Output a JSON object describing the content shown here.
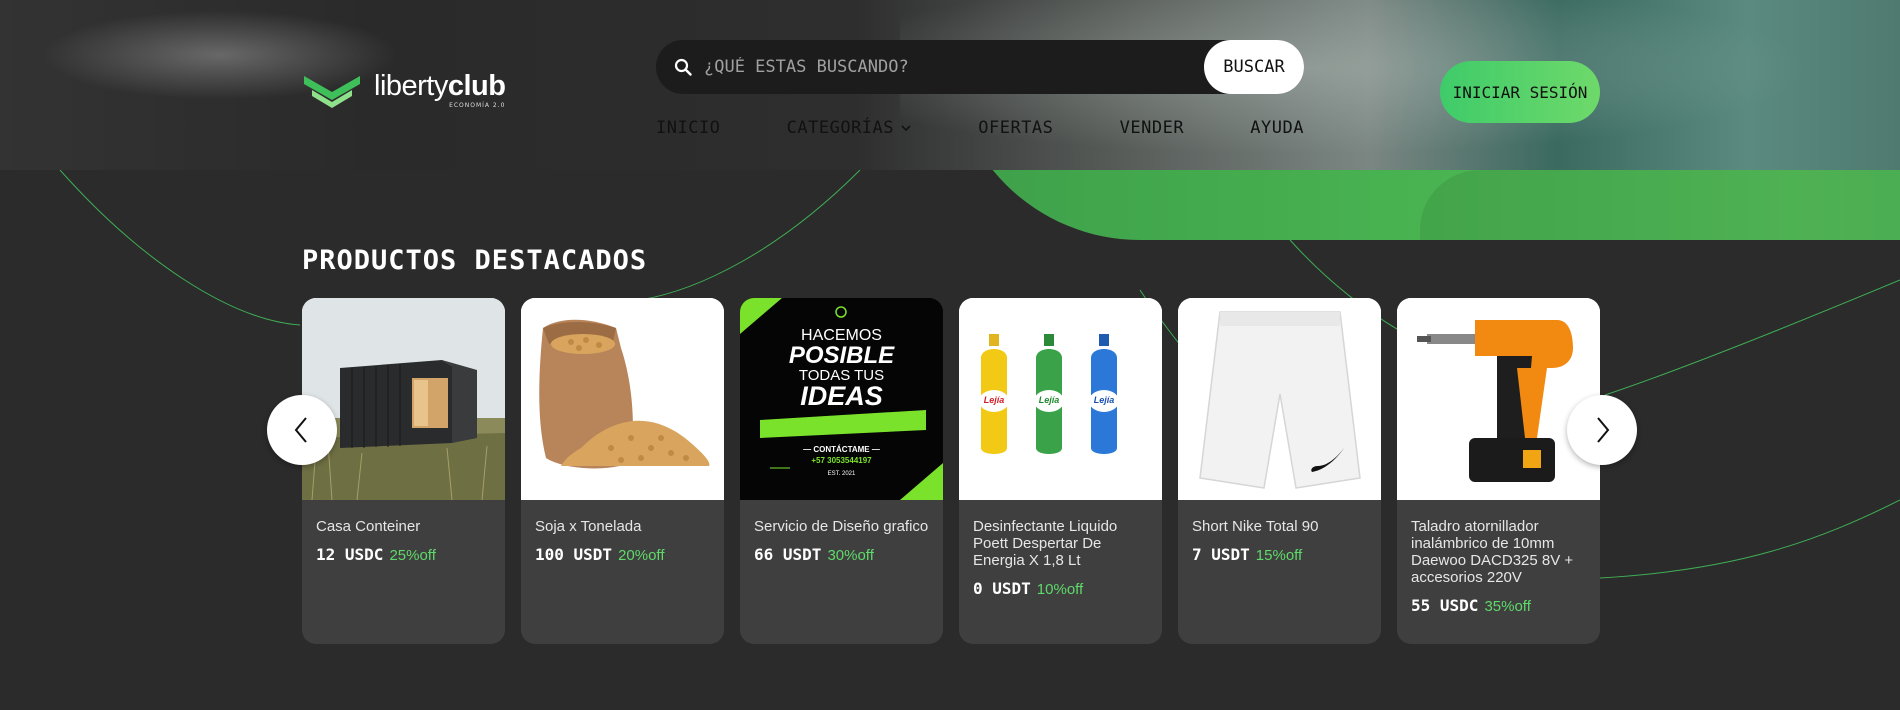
{
  "header": {
    "logo": {
      "name_light": "liberty",
      "name_bold": "club",
      "subtitle": "ECONOMÍA 2.0"
    },
    "search": {
      "placeholder": "¿QUÉ ESTAS BUSCANDO?",
      "button_label": "BUSCAR"
    },
    "nav": [
      {
        "label": "INICIO"
      },
      {
        "label": "CATEGORÍAS"
      },
      {
        "label": "OFERTAS"
      },
      {
        "label": "VENDER"
      },
      {
        "label": "AYUDA"
      }
    ],
    "login_label": "INICIAR SESIÓN"
  },
  "featured": {
    "title": "PRODUCTOS DESTACADOS",
    "products": [
      {
        "title": "Casa Conteiner",
        "price": "12 USDC",
        "discount": "25%off",
        "image": "container-house"
      },
      {
        "title": "Soja x Tonelada",
        "price": "100 USDT",
        "discount": "20%off",
        "image": "soybean-sack"
      },
      {
        "title": "Servicio de Diseño grafico",
        "price": "66 USDT",
        "discount": "30%off",
        "image": "design-poster",
        "poster": {
          "line1": "HACEMOS",
          "line2": "POSIBLE",
          "line3": "TODAS TUS",
          "line4": "IDEAS",
          "contact_label": "— CONTÁCTAME —",
          "phone": "+57 3053544197",
          "est": "EST. 2021"
        }
      },
      {
        "title": "Desinfectante Liquido Poett Despertar De Energia X 1,8 Lt",
        "price": "0 USDT",
        "discount": "10%off",
        "image": "bleach-bottles",
        "bottle_label": "Lejía"
      },
      {
        "title": "Short Nike Total 90",
        "price": "7 USDT",
        "discount": "15%off",
        "image": "white-shorts"
      },
      {
        "title": "Taladro atornillador inalámbrico de 10mm Daewoo DACD325 8V + accesorios 220V",
        "price": "55 USDC",
        "discount": "35%off",
        "image": "cordless-drill"
      }
    ]
  },
  "colors": {
    "accent_green": "#5fd96a",
    "login_gradient_start": "#3fcb6a",
    "login_gradient_end": "#6ed96a",
    "background": "#2b2b2b",
    "card_background": "#3f3f3f"
  }
}
